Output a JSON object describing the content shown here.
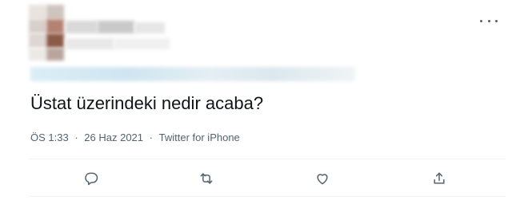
{
  "tweet": {
    "text": "Üstat üzerindeki nedir acaba?",
    "time": "ÖS 1:33",
    "date": "26 Haz 2021",
    "source": "Twitter for iPhone",
    "separator": "·"
  },
  "icons": {
    "more": "more-horizontal-icon",
    "reply": "reply-icon",
    "retweet": "retweet-icon",
    "like": "heart-icon",
    "share": "share-icon"
  },
  "colors": {
    "text": "#0f1419",
    "secondary": "#536471",
    "divider": "#eff3f4"
  }
}
